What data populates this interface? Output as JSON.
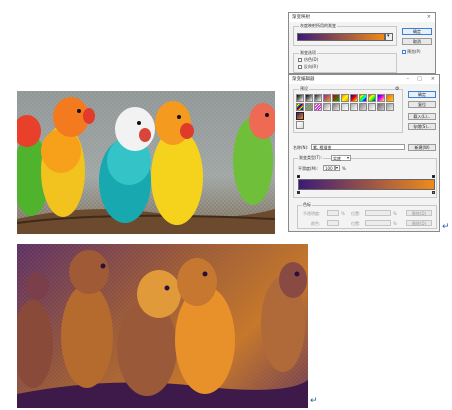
{
  "gradient_map_dialog": {
    "title": "渐变映射",
    "group_title": "灰度映射所用的渐变",
    "ok": "确定",
    "cancel": "取消",
    "preview": "预览(P)",
    "options_title": "渐变选项",
    "dither": "仿色(D)",
    "reverse": "反向(R)"
  },
  "gradient_editor": {
    "title": "渐变编辑器",
    "presets_label": "预设",
    "ok": "确定",
    "reset": "复位",
    "load": "载入(L)...",
    "save": "存储(S)...",
    "name_label": "名称(N):",
    "name_value": "紫, 橙渐变",
    "new_button": "新建(W)",
    "type_label": "渐变类型(T):",
    "type_value": "实底",
    "smooth_label": "平滑度(M):",
    "smooth_value": "100",
    "smooth_unit": "%",
    "stops_title": "色标",
    "opacity_label": "不透明度:",
    "location_label": "位置:",
    "delete_label": "删除(D)",
    "color_label": "颜色:",
    "pct": "%"
  },
  "gradient_colors": {
    "start": "#3d1a78",
    "end": "#f08a1a"
  },
  "colors": {
    "accent": "#3c7fd6",
    "paragraph_mark": "#2e5fa8"
  },
  "paragraph_mark": "↵"
}
